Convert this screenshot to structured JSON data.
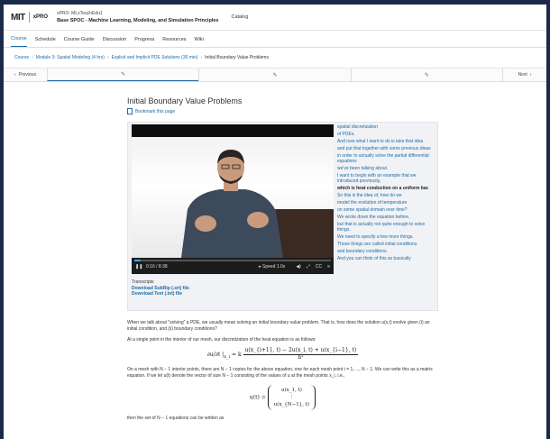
{
  "header": {
    "logo_text": "MIT",
    "xpro_text": "xPRO",
    "org": "xPRO: MLxTouchEdu1",
    "course_title": "Base SPOC - Machine Learning, Modeling, and Simulation Principles",
    "catalog_label": "Catalog"
  },
  "tabs": [
    "Course",
    "Schedule",
    "Course Guide",
    "Discussion",
    "Progress",
    "Resources",
    "Wiki"
  ],
  "breadcrumb": {
    "course": "Course",
    "module": "Module 3: Spatial Modeling (4 hrs)",
    "section": "Explicit and Implicit PDE Solutions (30 min)",
    "current": "Initial Boundary Value Problems"
  },
  "sequence_nav": {
    "previous_label": "Previous",
    "next_label": "Next"
  },
  "page": {
    "title": "Initial Boundary Value Problems",
    "bookmark_label": "Bookmark this page"
  },
  "video": {
    "time": "0:16 / 8:38",
    "speed": "Speed 1.0x",
    "progress_fraction": 0.03
  },
  "transcript_lines": [
    "spatial discretization",
    "of PDEs.",
    "And now what I want to do is take that idea",
    "and put that together with some previous ideas",
    "in order to actually solve the partial differential equations",
    "we've been talking about.",
    "I want to begin with an example that we introduced previously,",
    "which is heat conduction on a uniform bar.",
    "So this is the idea of, how do we",
    "model the evolution of temperature",
    "on some spatial domain over time?",
    "We wrote down the equation before,",
    "but that is actually not quite enough to solve things.",
    "We need to specify a few more things.",
    "Those things are called initial conditions",
    "and boundary conditions.",
    "And you can think of this as basically"
  ],
  "transcript_current_index": 7,
  "transcripts": {
    "label": "Transcripts",
    "srt_link": "Download SubRip (.srt) file",
    "txt_link": "Download Text (.txt) file"
  },
  "body": {
    "p1": "When we talk about \"solving\" a PDE, we usually mean solving an initial boundary value problem. That is, how does the solution u(x,t) evolve given (i) an initial condition, and (ii) boundary conditions?",
    "p2": "At a single point in the interior of our mesh, our discretization of the heat equation is as follows:",
    "eq1_lhs": "∂u/∂t |",
    "eq1_sub": "x_i",
    "eq1_k": "= k",
    "eq1_num": "u(x_{i+1}, t) − 2u(x_i, t) + u(x_{i−1}, t)",
    "eq1_den": "h²",
    "p3": "On a mesh with N − 1 interior points, there are N − 1 copies for the above equation, one for each mesh point i = 1, ..., N − 1. We can write this as a matrix equation. If we let u(t) denote the vector of size N − 1 consisting of the values of u at the mesh points x_i, i.e.,",
    "eq2_lhs": "u(t) =",
    "eq2_rows": [
      "u(x_1, t)",
      "⋮",
      "u(x_{N−1}, t)"
    ],
    "p4": "then the set of N − 1 equations can be written as"
  }
}
